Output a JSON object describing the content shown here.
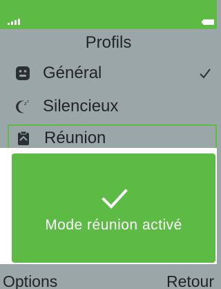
{
  "status_bar": {
    "signal_icon": "signal-bars-icon",
    "battery_icon": "battery-icon",
    "color": "#5cba45"
  },
  "screen": {
    "title": "Profils"
  },
  "profiles": [
    {
      "label": "Général",
      "icon": "smiley-icon",
      "active": true
    },
    {
      "label": "Silencieux",
      "icon": "moon-sleep-icon",
      "active": false
    },
    {
      "label": "Réunion",
      "icon": "clipboard-icon",
      "active": false,
      "focused": true
    }
  ],
  "toast": {
    "icon": "checkmark-icon",
    "message": "Mode réunion activé",
    "color": "#5cba45"
  },
  "softkeys": {
    "left": "Options",
    "right": "Retour"
  }
}
